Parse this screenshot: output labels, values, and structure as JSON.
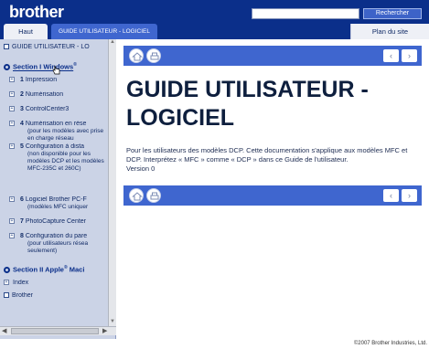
{
  "header": {
    "logo": "brother",
    "search_placeholder": "",
    "search_button": "Rechercher",
    "tab_home": "Haut",
    "tab_guide": "GUIDE UTILISATEUR - LOGICIEL",
    "sitemap": "Plan du site"
  },
  "sidebar": {
    "root": "GUIDE UTILISATEUR - LO",
    "section1": "Section I Windows",
    "section1_sup": "®",
    "items": [
      {
        "num": "1",
        "label": " Impression"
      },
      {
        "num": "2",
        "label": " Numérisation"
      },
      {
        "num": "3",
        "label": " ControlCenter3"
      },
      {
        "num": "4",
        "label": " Numérisation en rése"
      },
      {
        "num": "5",
        "label": " Configuration à dista"
      },
      {
        "num": "6",
        "label": " Logiciel Brother PC-F"
      },
      {
        "num": "7",
        "label": " PhotoCapture Center"
      },
      {
        "num": "8",
        "label": " Configuration du pare"
      }
    ],
    "item4_sub": "(pour les modèles avec prise en charge réseau",
    "item5_sub": "(non disponible pour les modèles DCP et les modèles MFC-235C et 260C)",
    "item6_sub": "(modèles MFC uniquer",
    "item8_sub": "(pour utilisateurs résea seulement)",
    "section2": "Section II Apple",
    "section2_sup": "®",
    "section2_tail": " Maci",
    "index": "Index",
    "brother": "Brother"
  },
  "content": {
    "title": "GUIDE UTILISATEUR - LOGICIEL",
    "intro": "Pour les utilisateurs des modèles DCP. Cette documentation s'applique aux modèles MFC et DCP. Interprétez « MFC » comme « DCP » dans ce Guide de l'utilisateur.",
    "version": "Version 0"
  },
  "nav": {
    "prev": "‹",
    "next": "›"
  },
  "footer": {
    "copyright": "©2007 Brother Industries, Ltd."
  }
}
